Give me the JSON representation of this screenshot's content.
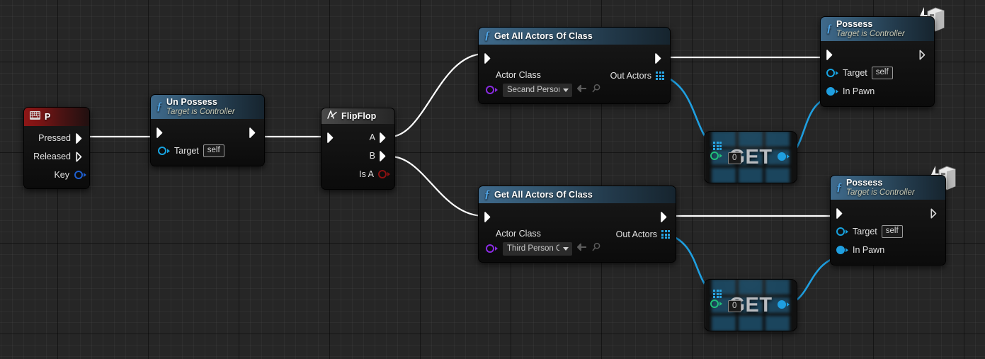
{
  "graph": {
    "app": "unreal-blueprint-graph",
    "background_color": "#262626",
    "grid_color": "#2e2e2e",
    "exec_wire_color": "#ffffff",
    "data_wire_color": "#1f9fe0"
  },
  "nodes": {
    "input_event_p": {
      "title": "P",
      "icon": "keyboard-icon",
      "pins": [
        {
          "label": "Pressed",
          "kind": "exec-out",
          "connected": true
        },
        {
          "label": "Released",
          "kind": "exec-out",
          "connected": false
        },
        {
          "label": "Key",
          "kind": "data-out",
          "color": "#1f5fd0",
          "connected": false
        }
      ]
    },
    "un_possess": {
      "title": "Un Possess",
      "subtitle": "Target is Controller",
      "icon": "function-icon",
      "in_exec": "",
      "out_exec": "",
      "target_label": "Target",
      "target_value": "self"
    },
    "flip_flop": {
      "title": "FlipFlop",
      "icon": "flipflop-icon",
      "out_a": "A",
      "out_b": "B",
      "out_is_a": "Is A"
    },
    "get_all_actors_top": {
      "title": "Get All Actors Of Class",
      "icon": "function-icon",
      "actor_class_label": "Actor Class",
      "actor_class_value": "Secand Person",
      "out_actors_label": "Out Actors",
      "browse_icon": "back-arrow-icon",
      "search_icon": "magnifier-icon"
    },
    "get_all_actors_bottom": {
      "title": "Get All Actors Of Class",
      "icon": "function-icon",
      "actor_class_label": "Actor Class",
      "actor_class_value": "Third Person Cha",
      "out_actors_label": "Out Actors",
      "browse_icon": "back-arrow-icon",
      "search_icon": "magnifier-icon"
    },
    "get_top": {
      "title": "GET",
      "index_value": "0",
      "array_icon": "array-grid-icon"
    },
    "get_bottom": {
      "title": "GET",
      "index_value": "0",
      "array_icon": "array-grid-icon"
    },
    "possess_top": {
      "title": "Possess",
      "subtitle": "Target is Controller",
      "icon": "function-icon",
      "badge_icon": "authority-server-icon",
      "target_label": "Target",
      "target_value": "self",
      "in_pawn_label": "In Pawn"
    },
    "possess_bottom": {
      "title": "Possess",
      "subtitle": "Target is Controller",
      "icon": "function-icon",
      "badge_icon": "authority-server-icon",
      "target_label": "Target",
      "target_value": "self",
      "in_pawn_label": "In Pawn"
    }
  }
}
